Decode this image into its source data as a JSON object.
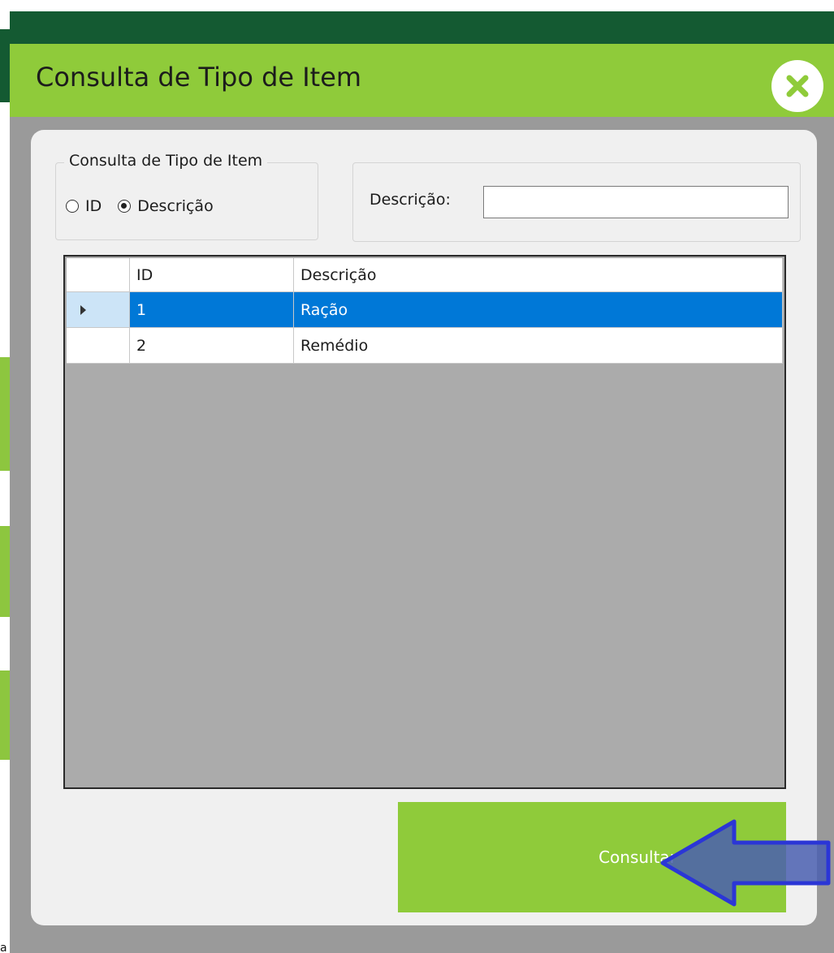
{
  "dialog": {
    "title": "Consulta de Tipo de Item",
    "close_icon": "close-x-icon"
  },
  "filter": {
    "group_title": "Consulta de Tipo de Item",
    "options": [
      {
        "label": "ID",
        "checked": false
      },
      {
        "label": "Descrição",
        "checked": true
      }
    ],
    "search_label": "Descrição:",
    "search_value": ""
  },
  "grid": {
    "columns": [
      "ID",
      "Descrição"
    ],
    "rows": [
      {
        "id": "1",
        "descricao": "Ração",
        "selected": true
      },
      {
        "id": "2",
        "descricao": "Remédio",
        "selected": false
      }
    ]
  },
  "actions": {
    "consult_label": "Consultar"
  },
  "colors": {
    "accent_green": "#8fcb3a",
    "dark_green": "#145a32",
    "selection_blue": "#0078d7",
    "annotation_arrow": "#4a5fb0"
  }
}
